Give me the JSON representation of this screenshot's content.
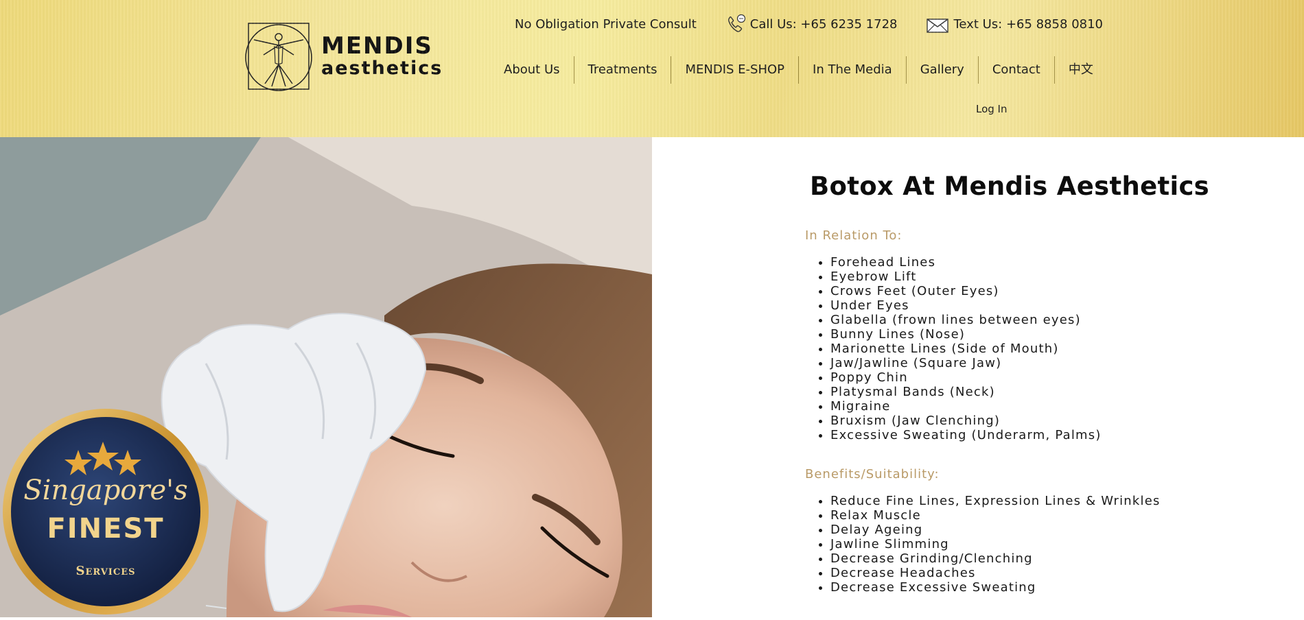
{
  "brand": {
    "name_main": "MENDIS",
    "name_sub": "aesthetics"
  },
  "topbar": {
    "consult": "No Obligation Private Consult",
    "call": "Call Us: +65 6235 1728",
    "text": "Text Us: +65 8858 0810"
  },
  "nav": {
    "items": [
      "About Us",
      "Treatments",
      "MENDIS E-SHOP",
      "In The Media",
      "Gallery",
      "Contact",
      "中文"
    ],
    "login": "Log In"
  },
  "badge": {
    "line1": "Singapore's",
    "line2": "FINEST",
    "line3": "Services"
  },
  "main": {
    "title": "Botox At Mendis Aesthetics",
    "relation_heading": "In Relation To:",
    "relation_items": [
      "Forehead Lines",
      "Eyebrow Lift",
      "Crows Feet (Outer Eyes)",
      "Under Eyes",
      "Glabella (frown lines between eyes)",
      "Bunny Lines (Nose)",
      "Marionette Lines (Side of Mouth)",
      "Jaw/Jawline (Square Jaw)",
      "Poppy Chin",
      "Platysmal Bands (Neck)",
      "Migraine",
      "Bruxism (Jaw Clenching)",
      "Excessive Sweating (Underarm, Palms)"
    ],
    "benefits_heading": "Benefits/Suitability:",
    "benefits_items": [
      "Reduce Fine Lines, Expression Lines & Wrinkles",
      "Relax Muscle",
      "Delay Ageing",
      "Jawline Slimming",
      "Decrease Grinding/Clenching",
      "Decrease Headaches",
      "Decrease Excessive Sweating"
    ]
  },
  "colors": {
    "accent_gold": "#b99a67",
    "header_gold": "#f3e494",
    "badge_navy": "#1b2a52"
  },
  "icons": [
    "phone-icon",
    "envelope-icon",
    "vitruvian-logo-icon"
  ]
}
